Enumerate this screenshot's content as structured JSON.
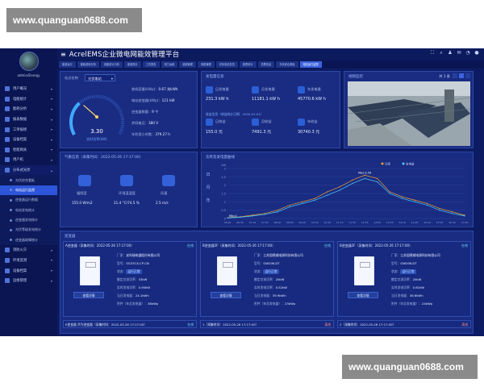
{
  "watermarks": {
    "top": "www.quanguan0688.com",
    "bottom": "www.quanguan0688.com"
  },
  "sidebar": {
    "username": "admin/Energy",
    "items": [
      {
        "label": "用户概况"
      },
      {
        "label": "电能统计"
      },
      {
        "label": "能耗分析"
      },
      {
        "label": "报表数据"
      },
      {
        "label": "工单报修"
      },
      {
        "label": "设备档案"
      },
      {
        "label": "智能网关"
      },
      {
        "label": "用户机"
      }
    ],
    "open_item": "分布式光伏",
    "subitems": [
      {
        "label": "光伏综合看板"
      },
      {
        "label": "电站运行监视"
      },
      {
        "label": "逆变器运行数据"
      },
      {
        "label": "电站发电统计"
      },
      {
        "label": "逆变器发电统计"
      },
      {
        "label": "光伏等级发电统计"
      },
      {
        "label": "逆变器故障统计"
      }
    ],
    "bottom_items": [
      {
        "label": "消防火灾"
      },
      {
        "label": "环境监测"
      },
      {
        "label": "设备档案"
      },
      {
        "label": "运维管理"
      }
    ]
  },
  "header": {
    "title": "AcrelEMS企业微电网能效管理平台"
  },
  "tabs": [
    {
      "label": "能源运行"
    },
    {
      "label": "能耗费用分析"
    },
    {
      "label": "用能统计分析"
    },
    {
      "label": "能源统计"
    },
    {
      "label": "工作报告"
    },
    {
      "label": "电力运维"
    },
    {
      "label": "能源管理"
    },
    {
      "label": "电能管理"
    },
    {
      "label": "光伏电站总览"
    },
    {
      "label": "报表统计"
    },
    {
      "label": "告警信息"
    },
    {
      "label": "光伏综合看板"
    },
    {
      "label": "电站运行监视"
    }
  ],
  "station": {
    "name_label": "站点名称",
    "name_value": "光伏电站",
    "gauge_value": "3.30",
    "gauge_label": "实时功率(kW)",
    "gauge_fill": 0.32,
    "rows": [
      {
        "k": "装机容量(kWp)：",
        "v": "0.67 兆kWh"
      },
      {
        "k": "电站逆变器(kWp)：",
        "v": "121 kW"
      },
      {
        "k": "逆变器数量：",
        "v": "9 个"
      },
      {
        "k": "并网电压：",
        "v": "380 V"
      },
      {
        "k": "年利用小时数：",
        "v": "379.27 h"
      }
    ]
  },
  "power": {
    "title": "发电量信息",
    "items": [
      {
        "k": "日发电量",
        "v": "231.3 kW h"
      },
      {
        "k": "月发电量",
        "v": "11181.1 kW h"
      },
      {
        "k": "年发电量",
        "v": "45770.6 kW h"
      }
    ],
    "income_title": "收益信息（收益统计日期：2020-01-01）",
    "income": [
      {
        "k": "日收益",
        "v": "155.0 元"
      },
      {
        "k": "月收益",
        "v": "7491.3 元"
      },
      {
        "k": "年收益",
        "v": "30740.3 元"
      }
    ]
  },
  "camera": {
    "title": "视频监控",
    "pager": "共 1 条"
  },
  "weather": {
    "title": "气象信息（采集时间：2022-05-26 17:17:00）",
    "items": [
      {
        "k": "辐照度",
        "v": "155.0 W/m2"
      },
      {
        "k": "环境温湿度",
        "v": "21.4 °C/74.5 %"
      },
      {
        "k": "风速",
        "v": "2.5 m/s"
      }
    ]
  },
  "chart_panel": {
    "title": "功率及发电量曲线",
    "side_chars": [
      "日",
      "月",
      "年"
    ]
  },
  "chart_data": {
    "type": "line",
    "ylabel": "kW",
    "ylim": [
      0,
      3
    ],
    "yticks": [
      "3",
      "2.5",
      "2",
      "1.5",
      "1",
      "0.5",
      "0"
    ],
    "legend": [
      "功率",
      "发电量"
    ],
    "max_label": "Max:0.59",
    "min_label": "Min:0",
    "categories": [
      "06:00",
      "06:35",
      "07:10",
      "07:45",
      "08:20",
      "08:55",
      "09:30",
      "10:05",
      "10:40",
      "11:15",
      "11:50",
      "12:25",
      "13:00",
      "13:35",
      "14:10",
      "14:45",
      "15:20",
      "15:55",
      "16:30",
      "17:05"
    ],
    "series": [
      {
        "name": "功率",
        "values": [
          0.05,
          0.1,
          0.2,
          0.3,
          0.5,
          0.8,
          1.0,
          1.2,
          1.6,
          1.9,
          2.3,
          2.6,
          2.4,
          1.6,
          1.3,
          1.1,
          0.9,
          0.6,
          0.4,
          0.2
        ]
      },
      {
        "name": "发电量",
        "values": [
          0.03,
          0.08,
          0.15,
          0.25,
          0.4,
          0.7,
          0.9,
          1.1,
          1.4,
          1.7,
          2.1,
          2.4,
          2.2,
          1.5,
          1.2,
          1.0,
          0.8,
          0.5,
          0.3,
          0.15
        ]
      }
    ]
  },
  "inverter_panel": {
    "title": "逆变器"
  },
  "inverters": [
    {
      "head": "A逆变器（采集时间：2022-05-26 17:17:00）",
      "tag": "在线",
      "rows": [
        {
          "k": "厂家：",
          "v": "安科瑞电器股份有限公司"
        },
        {
          "k": "型号：",
          "v": "SG33CX-CP-CN"
        },
        {
          "k": "状态：",
          "v": "运行正常"
        },
        {
          "k": "额定交流功率：",
          "v": "33kW"
        },
        {
          "k": "实时发电功率：",
          "v": "0.90kW"
        },
        {
          "k": "当日发电量：",
          "v": "24.1kWh"
        },
        {
          "k": "附件（年总发电量）：",
          "v": "38kWp"
        }
      ],
      "btn": "查看详情"
    },
    {
      "head": "B逆变器3F（采集时间：2022-05-26 17:17:00）",
      "tag": "在线",
      "rows": [
        {
          "k": "厂家：",
          "v": "江苏固德威电源科技有限公司"
        },
        {
          "k": "型号：",
          "v": "GW20K-DT"
        },
        {
          "k": "状态：",
          "v": "运行正常"
        },
        {
          "k": "额定交流功率：",
          "v": "20kW"
        },
        {
          "k": "实时发电功率：",
          "v": "0.52kW"
        },
        {
          "k": "当日发电量：",
          "v": "39.9kWh"
        },
        {
          "k": "附件（年总发电量）：",
          "v": "23kWp"
        }
      ],
      "btn": "查看详情"
    },
    {
      "head": "B逆变器2F（采集时间：2022-05-26 17:17:00）",
      "tag": "在线",
      "rows": [
        {
          "k": "厂家：",
          "v": "江苏固德威电源科技有限公司"
        },
        {
          "k": "型号：",
          "v": "GW20K-DT"
        },
        {
          "k": "状态：",
          "v": "运行正常"
        },
        {
          "k": "额定交流功率：",
          "v": "20kW"
        },
        {
          "k": "实时发电功率：",
          "v": "0.61kW"
        },
        {
          "k": "当日发电量：",
          "v": "38.6kWh"
        },
        {
          "k": "附件（年总发电量）：",
          "v": "24kWp"
        }
      ],
      "btn": "查看详情"
    }
  ],
  "inverters_bottom": [
    {
      "head": "E逆变器 华为逆变器（采集时间：2022-05-26 17:17:00）",
      "tag": "在线"
    },
    {
      "head": "1（采集时间：2022-05-26 17:17:00）",
      "tag": "离线"
    },
    {
      "head": "2（采集时间：2022-05-26 17:17:00）",
      "tag": "离线"
    }
  ]
}
